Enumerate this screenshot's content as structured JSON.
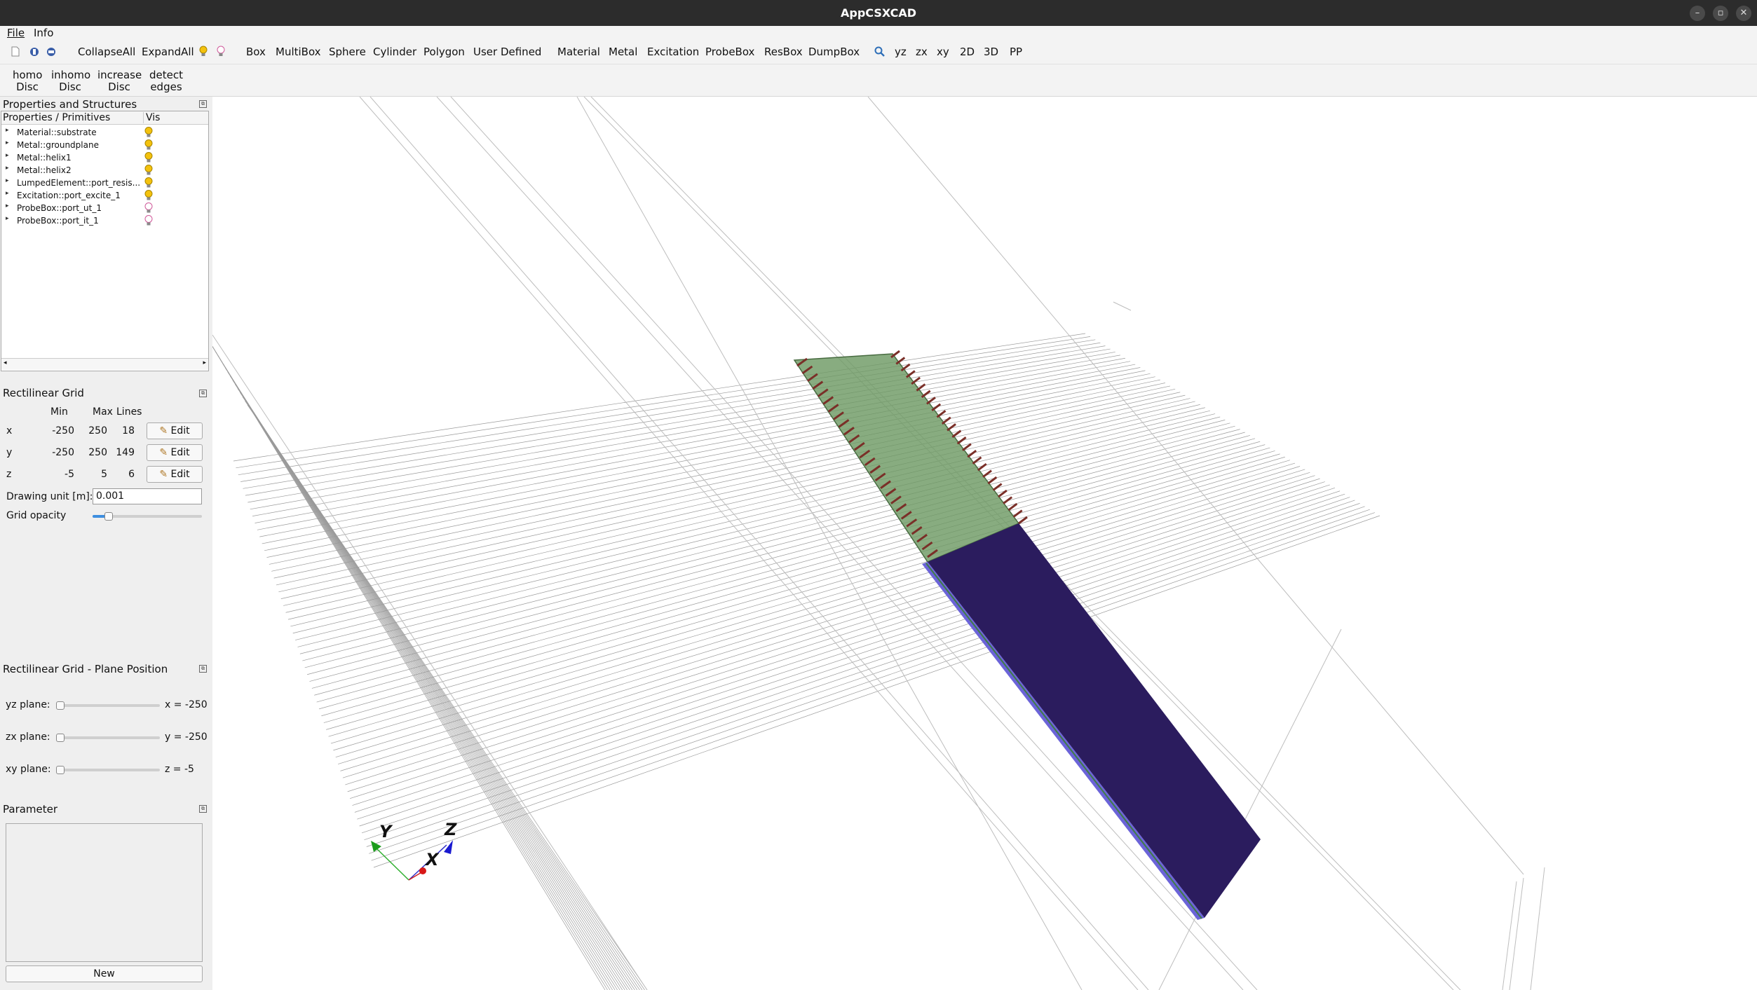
{
  "window": {
    "title": "AppCSXCAD"
  },
  "menu": {
    "file": "File",
    "info": "Info"
  },
  "toolbar": {
    "collapse_all": "CollapseAll",
    "expand_all": "ExpandAll",
    "box": "Box",
    "multibox": "MultiBox",
    "sphere": "Sphere",
    "cylinder": "Cylinder",
    "polygon": "Polygon",
    "user_defined": "User Defined",
    "material": "Material",
    "metal": "Metal",
    "excitation": "Excitation",
    "probebox": "ProbeBox",
    "resbox": "ResBox",
    "dumpbox": "DumpBox",
    "yz": "yz",
    "zx": "zx",
    "xy": "xy",
    "v2d": "2D",
    "v3d": "3D",
    "pp": "PP"
  },
  "toolbar2": {
    "homo_l1": "homo",
    "homo_l2": "Disc",
    "inhomo_l1": "inhomo",
    "inhomo_l2": "Disc",
    "increase_l1": "increase",
    "increase_l2": "Disc",
    "detect_l1": "detect",
    "detect_l2": "edges"
  },
  "props": {
    "title": "Properties and Structures",
    "col1": "Properties / Primitives",
    "col2": "Vis",
    "items": [
      {
        "label": "Material::substrate",
        "vis": "on"
      },
      {
        "label": "Metal::groundplane",
        "vis": "on"
      },
      {
        "label": "Metal::helix1",
        "vis": "on"
      },
      {
        "label": "Metal::helix2",
        "vis": "on"
      },
      {
        "label": "LumpedElement::port_resis...",
        "vis": "on"
      },
      {
        "label": "Excitation::port_excite_1",
        "vis": "on"
      },
      {
        "label": "ProbeBox::port_ut_1",
        "vis": "off"
      },
      {
        "label": "ProbeBox::port_it_1",
        "vis": "off"
      }
    ]
  },
  "grid": {
    "title": "Rectilinear Grid",
    "h_min": "Min",
    "h_max": "Max",
    "h_lines": "Lines",
    "rows": [
      {
        "axis": "x",
        "min": "-250",
        "max": "250",
        "lines": "18",
        "edit": "Edit"
      },
      {
        "axis": "y",
        "min": "-250",
        "max": "250",
        "lines": "149",
        "edit": "Edit"
      },
      {
        "axis": "z",
        "min": "-5",
        "max": "5",
        "lines": "6",
        "edit": "Edit"
      }
    ],
    "unit_label": "Drawing unit [m]:",
    "unit_value": "0.001",
    "opacity_label": "Grid opacity",
    "opacity_value": 0.15
  },
  "plane": {
    "title": "Rectilinear Grid - Plane Position",
    "yz_label": "yz plane:",
    "yz_value": "x = -250",
    "zx_label": "zx plane:",
    "zx_value": "y = -250",
    "xy_label": "xy plane:",
    "xy_value": "z = -5"
  },
  "parameter": {
    "title": "Parameter",
    "new": "New"
  },
  "axes": {
    "x": "X",
    "y": "Y",
    "z": "Z"
  },
  "colors": {
    "substrate": "#2b1c5e",
    "substrate_edge": "#6b63d8",
    "helix_plane": "#6e9a64",
    "wire": "#7a2f28"
  }
}
